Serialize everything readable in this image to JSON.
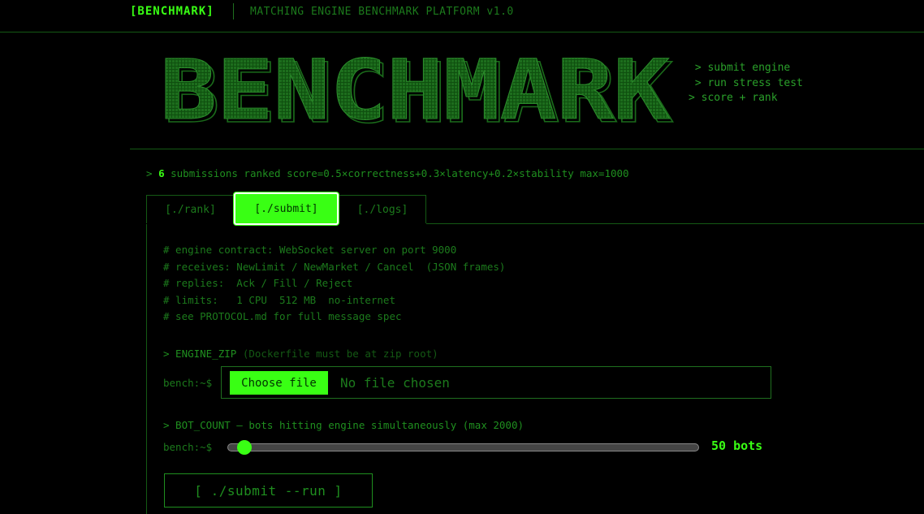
{
  "nav": {
    "brand": "[BENCHMARK]",
    "subtitle": "MATCHING ENGINE BENCHMARK PLATFORM v1.0"
  },
  "hero": {
    "banner_text": "BENCHMARK",
    "steps": [
      " > submit engine",
      " > run stress test",
      "> score + rank"
    ]
  },
  "stats": {
    "prefix": "> ",
    "count": "6",
    "text": " submissions ranked score=0.5×correctness+0.3×latency+0.2×stability max=1000"
  },
  "tabs": [
    {
      "label": "[./rank]"
    },
    {
      "label": "[./submit]"
    },
    {
      "label": "[./logs]"
    }
  ],
  "contract": {
    "lines": [
      "# engine contract: WebSocket server on port 9000",
      "# receives: NewLimit / NewMarket / Cancel  (JSON frames)",
      "# replies:  Ack / Fill / Reject",
      "# limits:   1 CPU  512 MB  no-internet",
      "# see PROTOCOL.md for full message spec"
    ]
  },
  "engine_zip": {
    "label": "> ENGINE_ZIP ",
    "hint": "(Dockerfile must be at zip root)",
    "prompt": "bench:~$",
    "button": "Choose file",
    "status": "No file chosen"
  },
  "bot_count": {
    "label": "> BOT_COUNT — bots hitting engine simultaneously (max 2000)",
    "prompt": "bench:~$",
    "value_label": "50 bots",
    "value": 50,
    "max": 2000
  },
  "run": {
    "label": "[ ./submit --run ]"
  },
  "colors": {
    "accent": "#39ff14",
    "text": "#1f8f1f",
    "dim": "#145a14",
    "background": "#000000"
  }
}
